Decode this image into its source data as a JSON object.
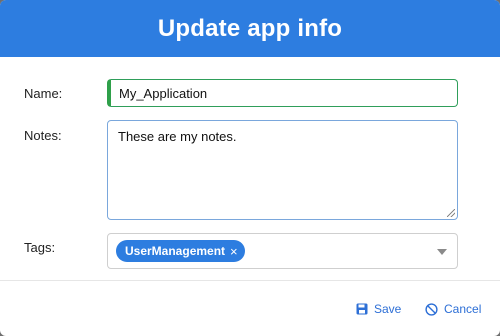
{
  "dialog": {
    "title": "Update app info"
  },
  "form": {
    "name_label": "Name:",
    "name_value": "My_Application",
    "notes_label": "Notes:",
    "notes_value": "These are my notes.",
    "tags_label": "Tags:",
    "tags": [
      {
        "label": "UserManagement",
        "remove_symbol": "×"
      }
    ]
  },
  "footer": {
    "save_label": "Save",
    "cancel_label": "Cancel",
    "save_icon": "floppy-disk-icon",
    "cancel_icon": "cancel-circle-icon"
  },
  "colors": {
    "header": "#2d7de0",
    "accent": "#2d6fd6",
    "valid": "#2fa04a"
  }
}
